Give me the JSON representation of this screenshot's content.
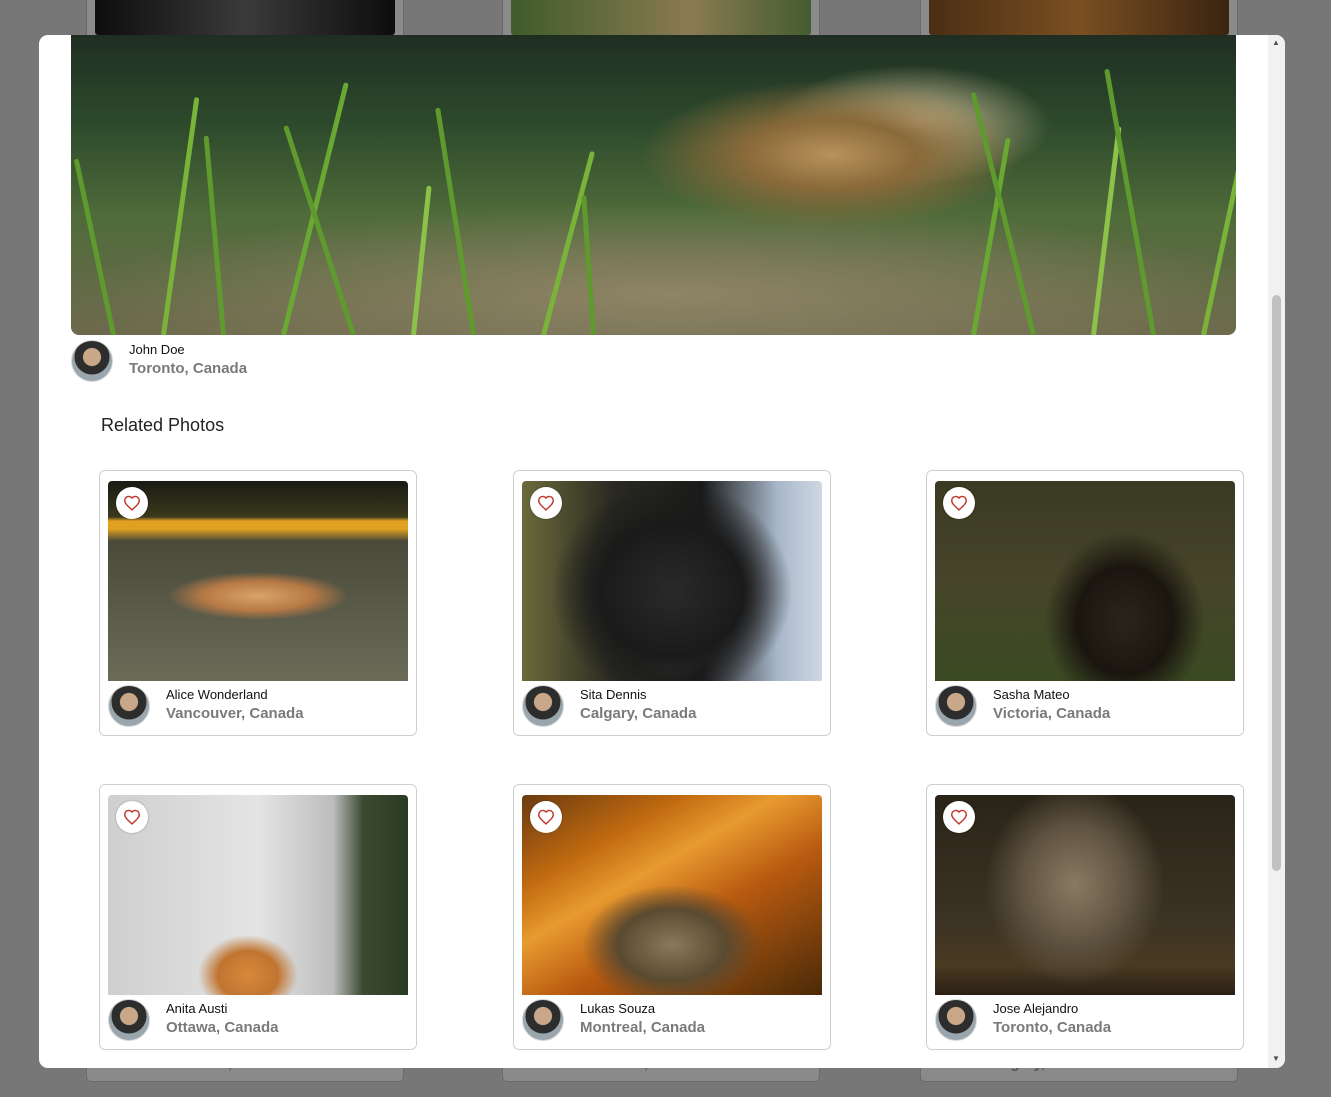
{
  "main_photo": {
    "owner_name": "John Doe",
    "owner_location": "Toronto, Canada"
  },
  "related": {
    "title": "Related Photos",
    "photos": [
      {
        "name": "Alice Wonderland",
        "location": "Vancouver, Canada",
        "subject": "dog lying on grass"
      },
      {
        "name": "Sita Dennis",
        "location": "Calgary, Canada",
        "subject": "black dog close-up"
      },
      {
        "name": "Sasha Mateo",
        "location": "Victoria, Canada",
        "subject": "black long-haired cat"
      },
      {
        "name": "Anita Austi",
        "location": "Ottawa, Canada",
        "subject": "orange cat by white wall"
      },
      {
        "name": "Lukas Souza",
        "location": "Montreal, Canada",
        "subject": "tabby cat sleeping in sunlight"
      },
      {
        "name": "Jose Alejandro",
        "location": "Toronto, Canada",
        "subject": "tabby cat drinking water"
      }
    ]
  },
  "background_cards": {
    "bottom_locations": [
      "Vancouver, Canada",
      "Vancouver, Canada",
      "Calgary, Canada"
    ]
  },
  "colors": {
    "overlay": "#777777",
    "modal_bg": "#ffffff",
    "heart_red": "#c0392b",
    "location_gray": "#7a7a7a"
  },
  "icons": {
    "favorite": "heart-outline-icon",
    "scroll_up": "triangle-up-icon",
    "scroll_down": "triangle-down-icon"
  }
}
